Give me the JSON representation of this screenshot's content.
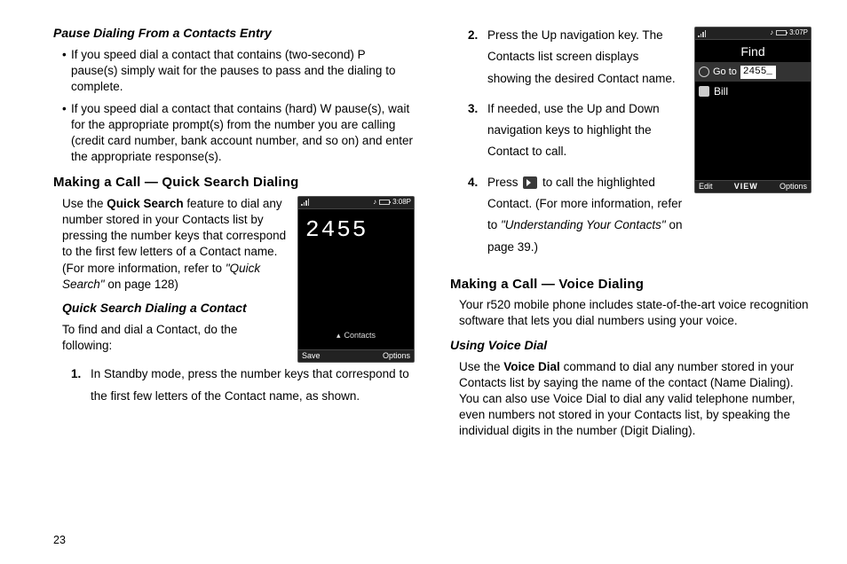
{
  "page_number": "23",
  "left": {
    "h_pause": "Pause Dialing From a Contacts Entry",
    "bullet1": "If you speed dial a contact that contains (two-second) P pause(s) simply wait for the pauses to pass and the dialing to complete.",
    "bullet2": "If you speed dial a contact that contains (hard) W pause(s), wait for the appropriate prompt(s) from the number you are calling (credit card number, bank account number, and so on) and enter the appropriate response(s).",
    "h_qsd": "Making a Call — Quick Search Dialing",
    "qsd_p1_a": "Use the ",
    "qsd_p1_bold": "Quick Search",
    "qsd_p1_b": " feature to dial any number stored in your Contacts list by pressing the number keys that correspond to the first few letters of a Contact name. (For more information, refer to ",
    "qsd_p1_ital": "\"Quick Search\"",
    "qsd_p1_c": " on page 128)",
    "h_qsd_sub": "Quick Search Dialing a Contact",
    "qsd_p2": "To find and dial a Contact, do the following:",
    "step1": "In Standby mode, press the number keys that correspond to the first few letters of the Contact name, as shown."
  },
  "right": {
    "step2": "Press the Up navigation key. The Contacts list screen displays showing the desired Contact name.",
    "step3": "If needed, use the Up and Down navigation keys to highlight the Contact to call.",
    "step4_a": "Press ",
    "step4_b": " to call the highlighted Contact. (For more information, refer to ",
    "step4_ital": "\"Understanding Your Contacts\"",
    "step4_c": "  on page 39.)",
    "h_voice": "Making a Call — Voice Dialing",
    "voice_p1": "Your r520 mobile phone includes state-of-the-art voice recognition software that lets you dial numbers using your voice.",
    "h_uvd": "Using Voice Dial",
    "uvd_a": "Use the ",
    "uvd_bold": "Voice Dial",
    "uvd_b": " command to dial any number stored in your Contacts list by saying the name of the contact (Name Dialing). You can also use Voice Dial to dial any valid telephone number, even numbers not stored in your Contacts list, by speaking the individual digits in the number (Digit Dialing)."
  },
  "phone1": {
    "time": "3:08P",
    "entry": "2455",
    "pill": "Contacts",
    "soft_left": "Save",
    "soft_right": "Options"
  },
  "phone2": {
    "time": "3:07P",
    "find": "Find",
    "goto": "Go to",
    "goto_val": "2455_",
    "contact": "Bill",
    "soft_left": "Edit",
    "soft_center": "VIEW",
    "soft_right": "Options"
  }
}
